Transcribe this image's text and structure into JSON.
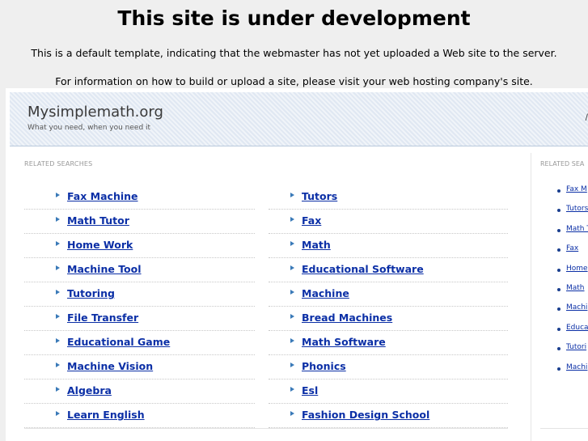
{
  "notice": {
    "title": "This site is under development",
    "line1": "This is a default template, indicating that the webmaster has not yet uploaded a Web site to the server.",
    "line2": "For information on how to build or upload a site, please visit your web hosting company's site."
  },
  "header": {
    "site_name": "Mysimplemath.org",
    "tagline": "What you need, when you need it",
    "edge_mark": "/"
  },
  "main": {
    "section_label": "RELATED SEARCHES",
    "left_links": [
      "Fax Machine",
      "Math Tutor",
      "Home Work",
      "Machine Tool",
      "Tutoring",
      "File Transfer",
      "Educational Game",
      "Machine Vision",
      "Algebra",
      "Learn English"
    ],
    "right_links": [
      "Tutors",
      "Fax",
      "Math",
      "Educational Software",
      "Machine",
      "Bread Machines",
      "Math Software",
      "Phonics",
      "Esl",
      "Fashion Design School"
    ]
  },
  "sidebar": {
    "section_label": "RELATED SEA",
    "links": [
      "Fax M",
      "Tutors",
      "Math T",
      "Fax",
      "Home",
      "Math",
      "Machi",
      "Educa",
      "Tutori",
      "Machi"
    ]
  },
  "colors": {
    "link": "#0b2fa6",
    "arrow": "#3a7ab8",
    "header_bg": "#e8eef6",
    "page_bg": "#efefef"
  }
}
